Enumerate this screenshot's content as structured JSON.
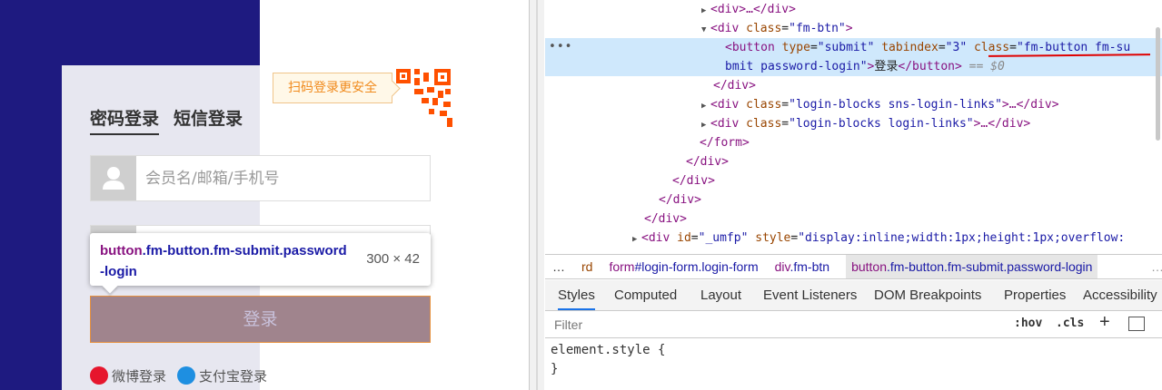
{
  "login": {
    "tab_password": "密码登录",
    "tab_sms": "短信登录",
    "qr_tip": "扫码登录更安全",
    "username_placeholder": "会员名/邮箱/手机号",
    "submit_label": "登录",
    "sns": [
      {
        "label": "微博登录"
      },
      {
        "label": "支付宝登录"
      }
    ]
  },
  "tooltip": {
    "tag": "button",
    "classes": ".fm-button.fm-submit.password-login",
    "size": "300 × 42"
  },
  "devtools": {
    "tree": {
      "l1": "<div>…</div>",
      "l2_tag": "div",
      "l2_class": "fm-btn",
      "l3_type": "submit",
      "l3_tabindex": "3",
      "l3_class_a": "fm-button fm-su",
      "l3_class_b": "bmit password-login",
      "l3_text": "登录",
      "l3_eq": "== $0",
      "l4": "</div>",
      "l5_class": "login-blocks sns-login-links",
      "l6_class": "login-blocks login-links",
      "l7": "</form>",
      "l8": "</div>",
      "l9": "</div>",
      "l10": "</div>",
      "l11_id": "_umfp",
      "l11_style": "display:inline;width:1px;height:1px;overflow:"
    },
    "breadcrumbs": {
      "c0": "rd",
      "c1_tag": "form",
      "c1_rest": "#login-form.login-form",
      "c2_tag": "div",
      "c2_rest": ".fm-btn",
      "c3_tag": "button",
      "c3_rest": ".fm-button.fm-submit.password-login",
      "more": "…",
      "overflow": "…"
    },
    "tabs": [
      "Styles",
      "Computed",
      "Layout",
      "Event Listeners",
      "DOM Breakpoints",
      "Properties",
      "Accessibility"
    ],
    "filter_placeholder": "Filter",
    "hov": ":hov",
    "cls": ".cls",
    "plus": "+",
    "element_style": "element.style {",
    "close_brace": "}"
  },
  "colors": {
    "page_blue": "#1e1a80",
    "button_fill": "#a0848d",
    "qr_orange": "#ff5000",
    "devtools_selected": "#cfe8fc",
    "tag_purple": "#881280",
    "attr_brown": "#994500",
    "value_blue": "#1a1aa6"
  }
}
